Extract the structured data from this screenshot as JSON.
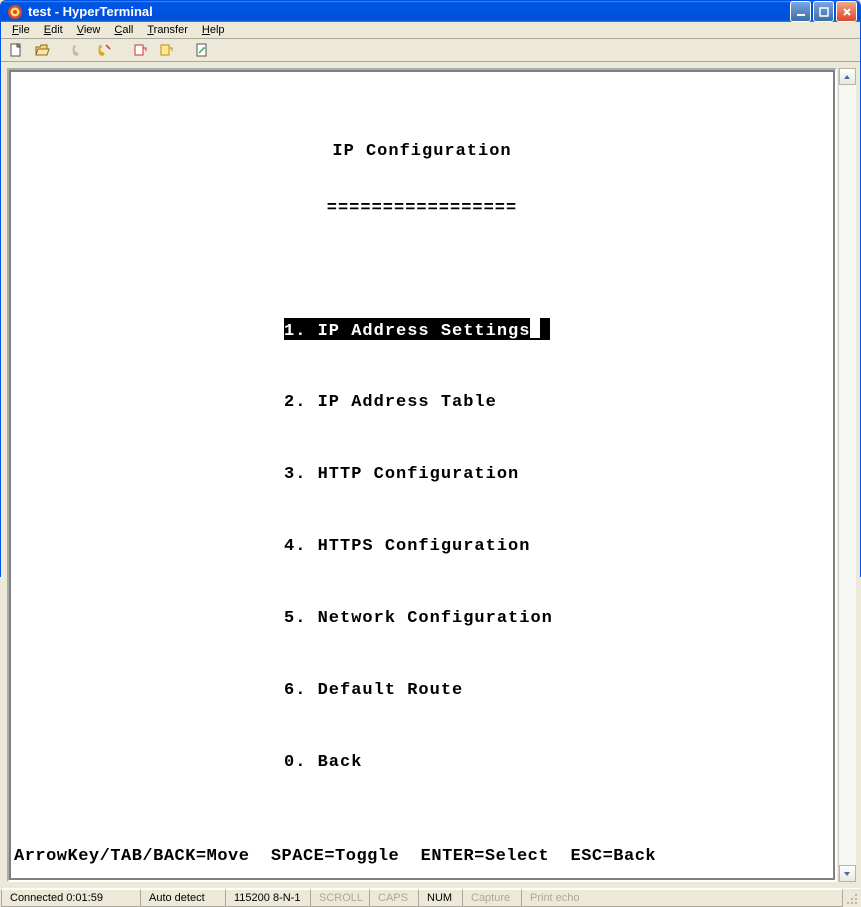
{
  "window": {
    "title": "test - HyperTerminal"
  },
  "menubar": {
    "file": "File",
    "edit": "Edit",
    "view": "View",
    "call": "Call",
    "transfer": "Transfer",
    "help": "Help"
  },
  "toolbar": {
    "new": "new-file",
    "open": "open-file",
    "call": "call",
    "disconnect": "disconnect",
    "send": "send",
    "receive": "receive",
    "properties": "properties"
  },
  "terminal": {
    "title": "IP Configuration",
    "underline": "=================",
    "items": [
      {
        "num": "1.",
        "label": "IP Address Settings",
        "selected": true
      },
      {
        "num": "2.",
        "label": "IP Address Table",
        "selected": false
      },
      {
        "num": "3.",
        "label": "HTTP Configuration",
        "selected": false
      },
      {
        "num": "4.",
        "label": "HTTPS Configuration",
        "selected": false
      },
      {
        "num": "5.",
        "label": "Network Configuration",
        "selected": false
      },
      {
        "num": "6.",
        "label": "Default Route",
        "selected": false
      },
      {
        "num": "0.",
        "label": "Back",
        "selected": false
      }
    ],
    "hints": "ArrowKey/TAB/BACK=Move  SPACE=Toggle  ENTER=Select  ESC=Back"
  },
  "statusbar": {
    "connected": "Connected 0:01:59",
    "autodetect": "Auto detect",
    "baud": "115200 8-N-1",
    "scroll": "SCROLL",
    "caps": "CAPS",
    "num": "NUM",
    "capture": "Capture",
    "printecho": "Print echo"
  }
}
